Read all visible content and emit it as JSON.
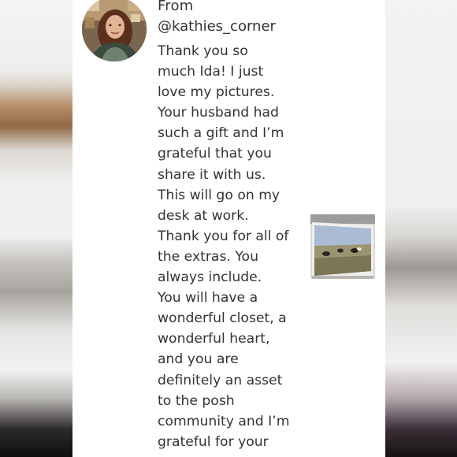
{
  "comment": {
    "from_label": "From",
    "username": "@kathies_corner",
    "message_lines": [
      "Thank you so",
      "much Ida! I just",
      "love my pictures.",
      "Your husband had",
      "such a gift and I’m",
      "grateful that you",
      "share it with us.",
      "This will go on my",
      "desk at work.",
      "Thank you for all of",
      "the extras. You",
      "always include.",
      "You will have a",
      "wonderful closet, a",
      "wonderful heart,",
      "and you are",
      "definitely an asset",
      "to the posh",
      "community and I’m",
      "grateful for your"
    ]
  },
  "icons": {
    "avatar": "user-avatar-photo",
    "attachment": "landscape-photo-thumbnail"
  },
  "colors": {
    "text": "#333333",
    "panel": "#ffffff"
  }
}
